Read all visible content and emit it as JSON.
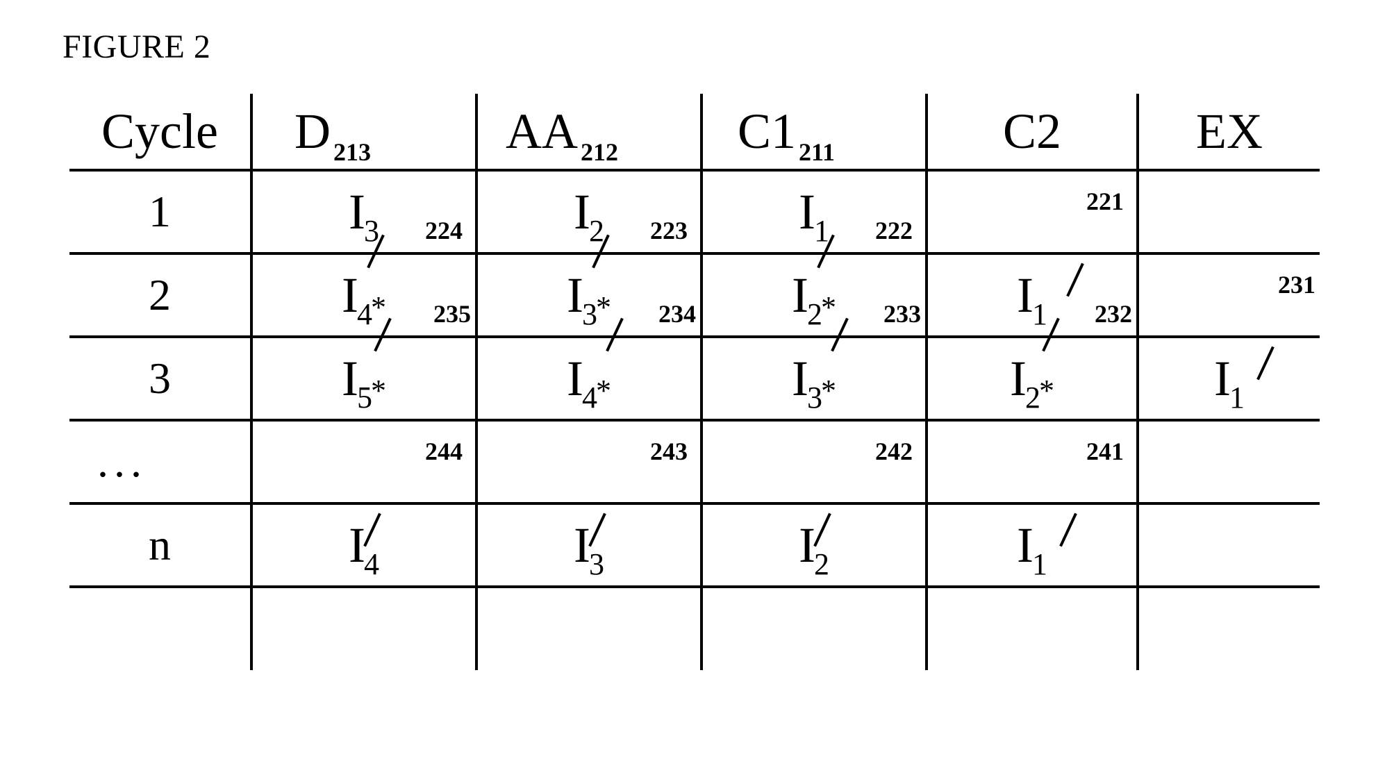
{
  "figure_title": "FIGURE 2",
  "columns": {
    "cycle": "Cycle",
    "d": {
      "label": "D",
      "ref": "213"
    },
    "aa": {
      "label": "AA",
      "ref": "212"
    },
    "c1": {
      "label": "C1",
      "ref": "211"
    },
    "c2": {
      "label": "C2"
    },
    "ex": {
      "label": "EX"
    }
  },
  "rows": [
    {
      "cycle": "1",
      "d": {
        "var": "I",
        "sub": "3",
        "star": false,
        "ref": "224"
      },
      "aa": {
        "var": "I",
        "sub": "2",
        "star": false,
        "ref": "223"
      },
      "c1": {
        "var": "I",
        "sub": "1",
        "star": false,
        "ref": "222"
      },
      "c2": {
        "ref": "221"
      },
      "ex": {}
    },
    {
      "cycle": "2",
      "d": {
        "var": "I",
        "sub": "4",
        "star": true,
        "ref": "235"
      },
      "aa": {
        "var": "I",
        "sub": "3",
        "star": true,
        "ref": "234"
      },
      "c1": {
        "var": "I",
        "sub": "2",
        "star": true,
        "ref": "233"
      },
      "c2": {
        "var": "I",
        "sub": "1",
        "star": false,
        "ref": "232"
      },
      "ex": {
        "ref": "231"
      }
    },
    {
      "cycle": "3",
      "d": {
        "var": "I",
        "sub": "5",
        "star": true
      },
      "aa": {
        "var": "I",
        "sub": "4",
        "star": true
      },
      "c1": {
        "var": "I",
        "sub": "3",
        "star": true
      },
      "c2": {
        "var": "I",
        "sub": "2",
        "star": true
      },
      "ex": {
        "var": "I",
        "sub": "1",
        "star": false
      }
    },
    {
      "cycle": "...",
      "d": {
        "ref": "244"
      },
      "aa": {
        "ref": "243"
      },
      "c1": {
        "ref": "242"
      },
      "c2": {
        "ref": "241"
      },
      "ex": {}
    },
    {
      "cycle": "n",
      "d": {
        "var": "I",
        "sub": "4",
        "star": false
      },
      "aa": {
        "var": "I",
        "sub": "3",
        "star": false
      },
      "c1": {
        "var": "I",
        "sub": "2",
        "star": false
      },
      "c2": {
        "var": "I",
        "sub": "1",
        "star": false
      },
      "ex": {}
    }
  ],
  "chart_data": {
    "type": "table",
    "title": "FIGURE 2 – Pipeline cycle table",
    "columns": [
      "Cycle",
      "D (213)",
      "AA (212)",
      "C1 (211)",
      "C2",
      "EX"
    ],
    "rows": [
      [
        "1",
        "I3",
        "I2",
        "I1",
        "",
        ""
      ],
      [
        "2",
        "I4*",
        "I3*",
        "I2*",
        "I1",
        ""
      ],
      [
        "3",
        "I5*",
        "I4*",
        "I3*",
        "I2*",
        "I1"
      ],
      [
        "...",
        "",
        "",
        "",
        "",
        ""
      ],
      [
        "n",
        "I4",
        "I3",
        "I2",
        "I1",
        ""
      ]
    ],
    "reference_numerals": {
      "D_header": 213,
      "AA_header": 212,
      "C1_header": 211,
      "row1_D": 224,
      "row1_AA": 223,
      "row1_C1": 222,
      "row1_C2": 221,
      "row2_D": 235,
      "row2_AA": 234,
      "row2_C1": 233,
      "row2_C2": 232,
      "row2_EX": 231,
      "row4_D": 244,
      "row4_AA": 243,
      "row4_C1": 242,
      "row4_C2": 241
    }
  }
}
